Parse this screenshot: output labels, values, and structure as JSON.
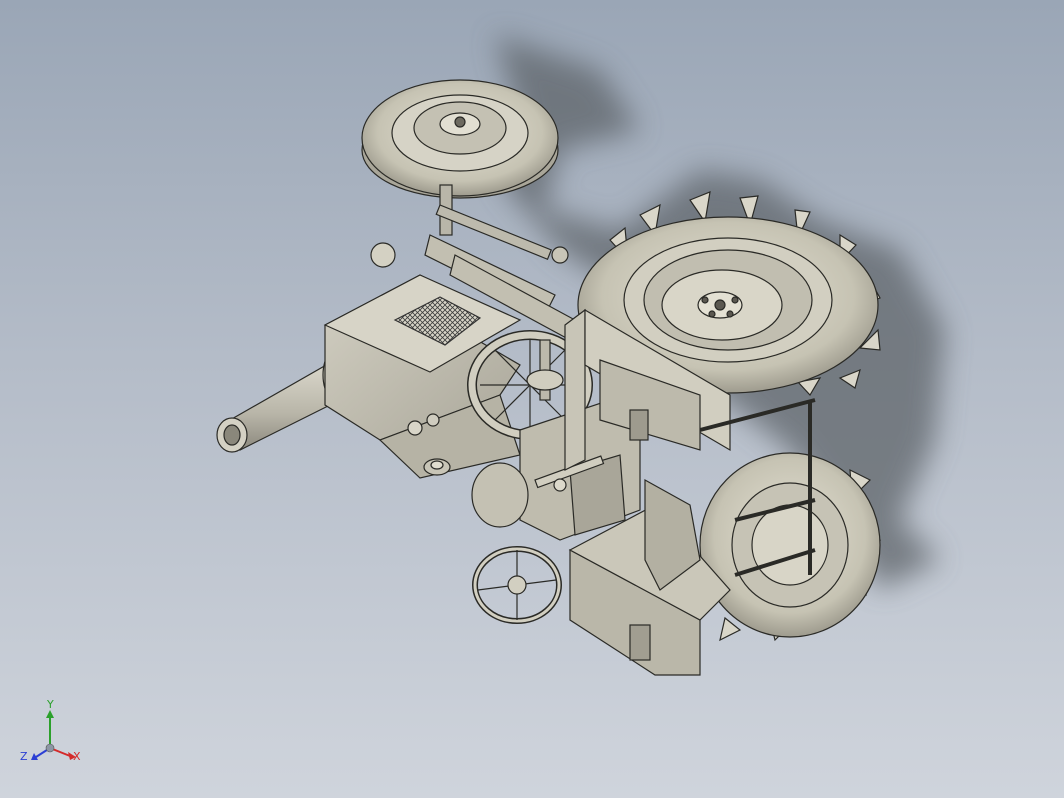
{
  "viewport": {
    "colors": {
      "background_top": "#9aa6b6",
      "background_bottom": "#cfd4dc",
      "model_body": "#c9c6b8",
      "model_shadow": "#6f7478",
      "edge": "#2a2a26",
      "mesh": "#4a4a4a"
    }
  },
  "model": {
    "icon": "tractor-model-icon"
  },
  "triad": {
    "x_label": "X",
    "y_label": "Y",
    "z_label": "Z",
    "colors": {
      "x": "#d42a2a",
      "y": "#2ba02b",
      "z": "#2b3fd4"
    }
  }
}
